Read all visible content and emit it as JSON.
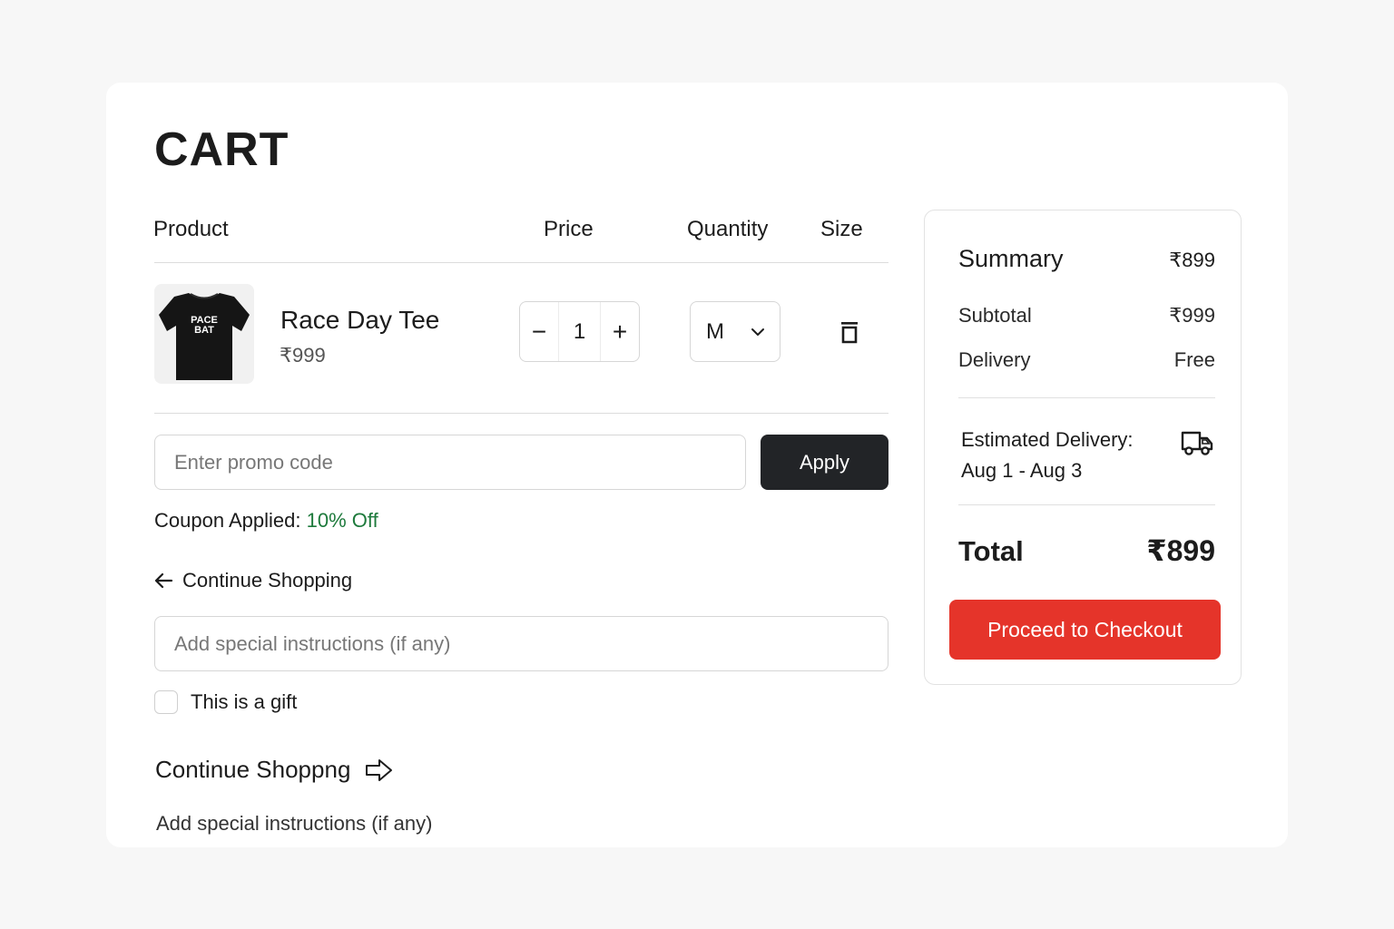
{
  "page": {
    "title": "CART"
  },
  "columns": {
    "product": "Product",
    "price": "Price",
    "quantity": "Quantity",
    "size": "Size"
  },
  "item": {
    "image_icon": "black-tshirt",
    "tee_print_line1": "PACE",
    "tee_print_line2": "BAT",
    "name": "Race Day Tee",
    "price": "₹999",
    "quantity": "1",
    "decrement_label": "−",
    "increment_label": "+",
    "size": "M",
    "size_icon": "chevron-down-icon",
    "remove_icon": "trash-icon"
  },
  "promo": {
    "placeholder": "Enter promo code",
    "value": "",
    "apply_label": "Apply",
    "coupon_label": "Coupon Applied:",
    "coupon_value": "10% Off",
    "coupon_color": "#1e7a3c"
  },
  "links": {
    "continue_shopping": "Continue Shopping",
    "continue_shopping_icon": "arrow-left-icon",
    "continue_shopping_alt": "Continue Shoppng",
    "continue_shopping_alt_icon": "arrow-right-outline-icon"
  },
  "instructions": {
    "placeholder": "Add special instructions (if any)",
    "value": "",
    "text": "Add special instructions (if any)"
  },
  "gift": {
    "label": "This is a gift",
    "checked": false
  },
  "summary": {
    "title": "Summary",
    "title_amount": "₹899",
    "subtotal_label": "Subtotal",
    "subtotal_value": "₹999",
    "delivery_label": "Delivery",
    "delivery_value": "Free",
    "estimated_label": "Estimated Delivery:",
    "estimated_range": "Aug 1 - Aug 3",
    "estimated_icon": "truck-icon",
    "total_label": "Total",
    "total_value": "₹899",
    "checkout_label": "Proceed to Checkout",
    "checkout_color": "#e5342a"
  }
}
